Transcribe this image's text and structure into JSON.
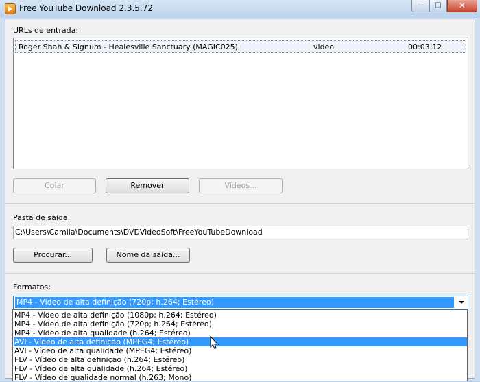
{
  "window": {
    "title": "Free YouTube Download 2.3.5.72"
  },
  "urls": {
    "label": "URLs de entrada:",
    "items": [
      {
        "title": "Roger Shah & Signum - Healesville Sanctuary (MAGIC025)",
        "type": "video",
        "duration": "00:03:12"
      }
    ],
    "buttons": {
      "paste": "Colar",
      "remove": "Remover",
      "videos": "Vídeos..."
    }
  },
  "output": {
    "label": "Pasta de saída:",
    "path": "C:\\Users\\Camila\\Documents\\DVDVideoSoft\\FreeYouTubeDownload",
    "buttons": {
      "browse": "Procurar...",
      "output_name": "Nome da saída..."
    }
  },
  "formats": {
    "label": "Formatos:",
    "selected": "MP4 - Vídeo de alta definição (720p; h.264; Estéreo)",
    "options": [
      "MP4 - Vídeo de alta definição (1080p; h.264; Estéreo)",
      "MP4 - Vídeo de alta definição (720p; h.264; Estéreo)",
      "MP4 - Vídeo de alta qualidade (h.264; Estéreo)",
      "AVI - Vídeo de alta definição (MPEG4; Estéreo)",
      "AVI - Vídeo de alta qualidade (MPEG4; Estéreo)",
      "FLV - Vídeo de alta definição (h.264; Estéreo)",
      "FLV - Vídeo de alta qualidade (h.264; Estéreo)",
      "FLV - Vídeo de qualidade normal (h.263; Mono)"
    ],
    "highlighted_index": 3
  },
  "icons": {
    "app": "play-icon",
    "minimize": "minimize-icon",
    "maximize": "maximize-icon",
    "close": "close-icon",
    "dropdown": "chevron-down-icon",
    "cursor": "mouse-pointer-icon"
  }
}
